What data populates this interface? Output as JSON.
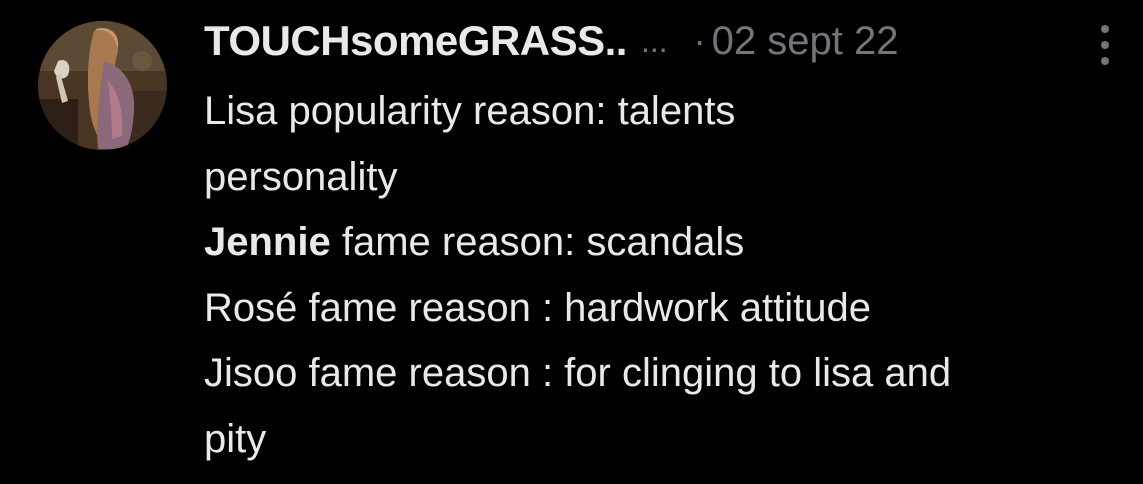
{
  "tweet": {
    "display_name": "TOUCHsomeGRASS..",
    "name_ellipsis": "...",
    "separator": "·",
    "date": "02 sept 22",
    "lines": [
      "Lisa popularity reason: talents",
      "personality",
      {
        "bold": "Jennie",
        "rest": " fame reason: scandals"
      },
      "Rosé fame reason : hardwork attitude",
      "Jisoo fame reason : for clinging to lisa and",
      "pity"
    ],
    "line_plain": {
      "l1": "Lisa popularity reason: talents",
      "l2": "personality",
      "l3_bold": "Jennie",
      "l3_rest": " fame reason: scandals",
      "l4": "Rosé fame reason : hardwork attitude",
      "l5": "Jisoo fame reason : for clinging to lisa and",
      "l6": "pity"
    }
  },
  "icons": {
    "more": "more-vertical-icon"
  },
  "colors": {
    "background": "#000000",
    "primary_text": "#e7e9ea",
    "secondary_text": "#71767b"
  }
}
